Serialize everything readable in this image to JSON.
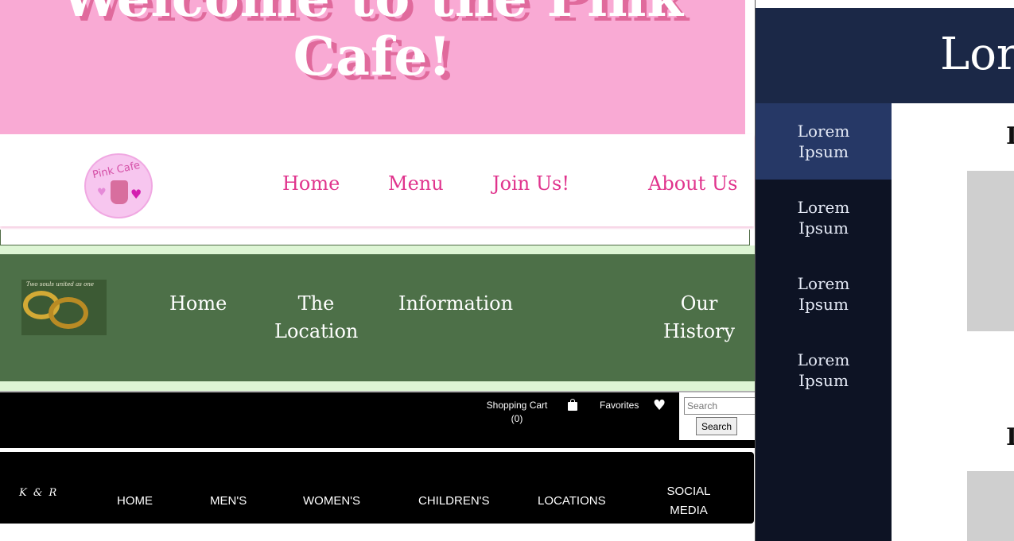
{
  "cafe": {
    "title_line1": "Welcome to the Pink",
    "title_line2": "Cafe!",
    "logo_text": "Pink Cafe",
    "nav": [
      "Home",
      "Menu",
      "Join Us!",
      "About Us"
    ],
    "colors": {
      "hero": "#f9aad4",
      "link": "#e0348d"
    }
  },
  "wedding": {
    "logo_caption": "Two souls united as one",
    "nav": [
      {
        "line1": "Home",
        "line2": ""
      },
      {
        "line1": "The",
        "line2": "Location"
      },
      {
        "line1": "Information",
        "line2": ""
      },
      {
        "line1": "Our",
        "line2": "History"
      }
    ],
    "colors": {
      "bar": "#4d7048"
    }
  },
  "shop": {
    "cart_label": "Shopping Cart",
    "cart_count": "(0)",
    "favorites_label": "Favorites",
    "search_placeholder": "Search",
    "search_button": "Search",
    "icons": [
      "shopping-bag-icon",
      "heart-icon"
    ]
  },
  "kr": {
    "logo": "K & R",
    "nav": [
      "HOME",
      "MEN'S",
      "WOMEN'S",
      "CHILDREN'S",
      "LOCATIONS"
    ],
    "social_line1": "SOCIAL",
    "social_line2": "MEDIA"
  },
  "right_page": {
    "title": "Lorem",
    "sidebar": [
      {
        "line1": "Lorem",
        "line2": "Ipsum"
      },
      {
        "line1": "Lorem",
        "line2": "Ipsum"
      },
      {
        "line1": "Lorem",
        "line2": "Ipsum"
      },
      {
        "line1": "Lorem",
        "line2": "Ipsum"
      }
    ],
    "headings": [
      "L",
      "L"
    ],
    "colors": {
      "header": "#1b2847",
      "sidebar": "#0d1324",
      "active": "#263866"
    }
  }
}
